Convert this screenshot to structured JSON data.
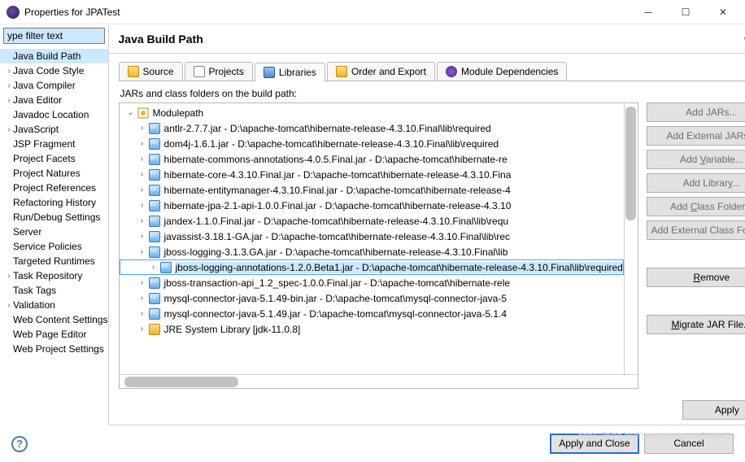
{
  "window": {
    "title": "Properties for JPATest"
  },
  "sidebar": {
    "filter_value": "ype filter text",
    "items": [
      {
        "label": "Java Build Path",
        "expandable": false,
        "selected": true
      },
      {
        "label": "Java Code Style",
        "expandable": true
      },
      {
        "label": "Java Compiler",
        "expandable": true
      },
      {
        "label": "Java Editor",
        "expandable": true
      },
      {
        "label": "Javadoc Location",
        "expandable": false
      },
      {
        "label": "JavaScript",
        "expandable": true
      },
      {
        "label": "JSP Fragment",
        "expandable": false
      },
      {
        "label": "Project Facets",
        "expandable": false
      },
      {
        "label": "Project Natures",
        "expandable": false
      },
      {
        "label": "Project References",
        "expandable": false
      },
      {
        "label": "Refactoring History",
        "expandable": false
      },
      {
        "label": "Run/Debug Settings",
        "expandable": false
      },
      {
        "label": "Server",
        "expandable": false
      },
      {
        "label": "Service Policies",
        "expandable": false
      },
      {
        "label": "Targeted Runtimes",
        "expandable": false
      },
      {
        "label": "Task Repository",
        "expandable": true
      },
      {
        "label": "Task Tags",
        "expandable": false
      },
      {
        "label": "Validation",
        "expandable": true
      },
      {
        "label": "Web Content Settings",
        "expandable": false
      },
      {
        "label": "Web Page Editor",
        "expandable": false
      },
      {
        "label": "Web Project Settings",
        "expandable": false
      }
    ]
  },
  "page": {
    "title": "Java Build Path",
    "tabs": [
      "Source",
      "Projects",
      "Libraries",
      "Order and Export",
      "Module Dependencies"
    ],
    "active_tab": 2,
    "subtitle": "JARs and class folders on the build path:",
    "modulepath_label": "Modulepath",
    "jars": [
      "antlr-2.7.7.jar - D:\\apache-tomcat\\hibernate-release-4.3.10.Final\\lib\\required",
      "dom4j-1.6.1.jar - D:\\apache-tomcat\\hibernate-release-4.3.10.Final\\lib\\required",
      "hibernate-commons-annotations-4.0.5.Final.jar - D:\\apache-tomcat\\hibernate-re",
      "hibernate-core-4.3.10.Final.jar - D:\\apache-tomcat\\hibernate-release-4.3.10.Fina",
      "hibernate-entitymanager-4.3.10.Final.jar - D:\\apache-tomcat\\hibernate-release-4",
      "hibernate-jpa-2.1-api-1.0.0.Final.jar - D:\\apache-tomcat\\hibernate-release-4.3.10",
      "jandex-1.1.0.Final.jar - D:\\apache-tomcat\\hibernate-release-4.3.10.Final\\lib\\requ",
      "javassist-3.18.1-GA.jar - D:\\apache-tomcat\\hibernate-release-4.3.10.Final\\lib\\rec",
      "jboss-logging-3.1.3.GA.jar - D:\\apache-tomcat\\hibernate-release-4.3.10.Final\\lib",
      "jboss-logging-annotations-1.2.0.Beta1.jar - D:\\apache-tomcat\\hibernate-release-4.3.10.Final\\lib\\required",
      "jboss-transaction-api_1.2_spec-1.0.0.Final.jar - D:\\apache-tomcat\\hibernate-rele",
      "mysql-connector-java-5.1.49-bin.jar - D:\\apache-tomcat\\mysql-connector-java-5",
      "mysql-connector-java-5.1.49.jar - D:\\apache-tomcat\\mysql-connector-java-5.1.4"
    ],
    "jre_label": "JRE System Library [jdk-11.0.8]",
    "selected_jar": 9
  },
  "buttons": {
    "add_jars": "Add JARs...",
    "add_ext": "Add External JARs...",
    "add_var": "Add Variable...",
    "add_lib": "Add Library...",
    "add_cf": "Add Class Folder...",
    "add_ecf": "Add External Class Folder...",
    "remove": "Remove",
    "migrate": "Migrate JAR File...",
    "apply": "Apply"
  },
  "footer": {
    "apply_close": "Apply and Close",
    "cancel": "Cancel"
  }
}
